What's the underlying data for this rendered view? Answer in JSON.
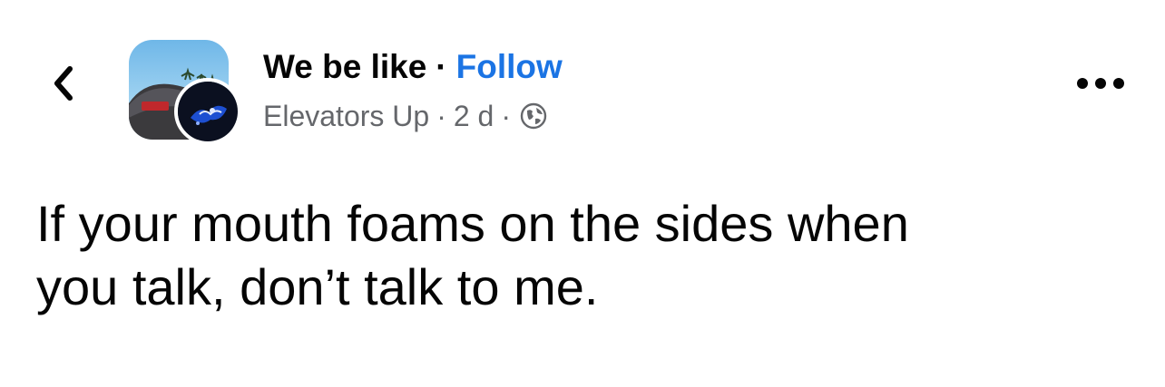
{
  "header": {
    "back_icon": "chevron-left-icon",
    "group_avatar_icon": "group-photo",
    "profile_avatar_icon": "profile-photo",
    "group_name": "We be like",
    "separator": "·",
    "follow_label": "Follow",
    "author": "Elevators Up",
    "meta_separator": "·",
    "time_ago": "2 d",
    "meta_separator_2": "·",
    "privacy_icon": "globe-icon",
    "more_icon": "more-options-icon"
  },
  "post": {
    "lines": [
      "If your mouth foams on the sides when",
      "you talk, don’t talk to me."
    ]
  },
  "colors": {
    "follow": "#1b74e4",
    "meta": "#65676b",
    "text": "#050505"
  }
}
